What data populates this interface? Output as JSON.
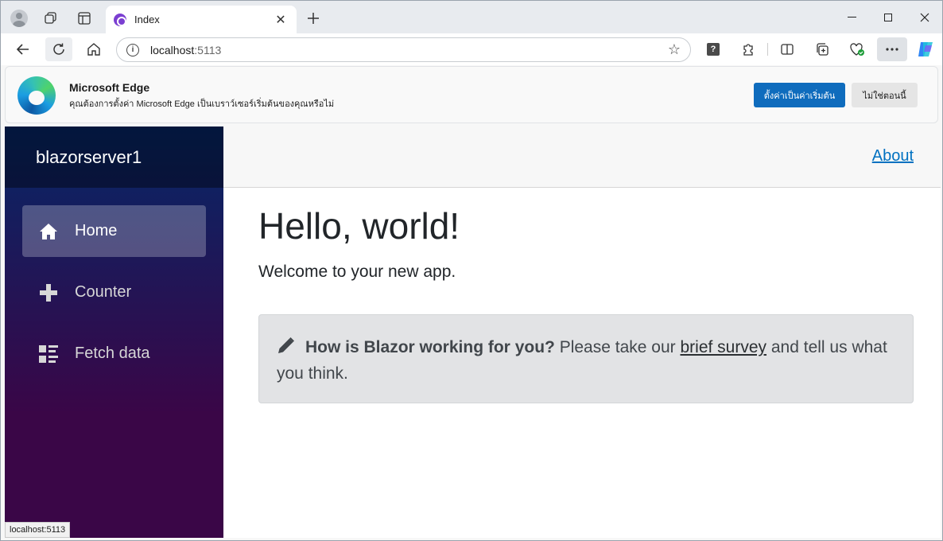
{
  "tab": {
    "title": "Index"
  },
  "address": {
    "host": "localhost",
    "port": ":5113"
  },
  "infobar": {
    "title": "Microsoft Edge",
    "message": "คุณต้องการตั้งค่า Microsoft Edge เป็นเบราว์เซอร์เริ่มต้นของคุณหรือไม่",
    "primary_label": "ตั้งค่าเป็นค่าเริ่มต้น",
    "secondary_label": "ไม่ใช่ตอนนี้"
  },
  "app": {
    "brand": "blazorserver1",
    "about_label": "About",
    "nav": [
      {
        "label": "Home",
        "icon": "home-icon",
        "active": true
      },
      {
        "label": "Counter",
        "icon": "plus-icon",
        "active": false
      },
      {
        "label": "Fetch data",
        "icon": "list-rich-icon",
        "active": false
      }
    ],
    "heading": "Hello, world!",
    "welcome": "Welcome to your new app.",
    "survey": {
      "question": "How is Blazor working for you?",
      "before_link": "Please take our",
      "link_text": "brief survey",
      "after_link": "and tell us what you think."
    }
  },
  "status_tip": "localhost:5113",
  "colors": {
    "sidebar_top": "#052767",
    "sidebar_bottom": "#3a0647",
    "link": "#0071c1",
    "infobar_button": "#0f6cbd"
  }
}
